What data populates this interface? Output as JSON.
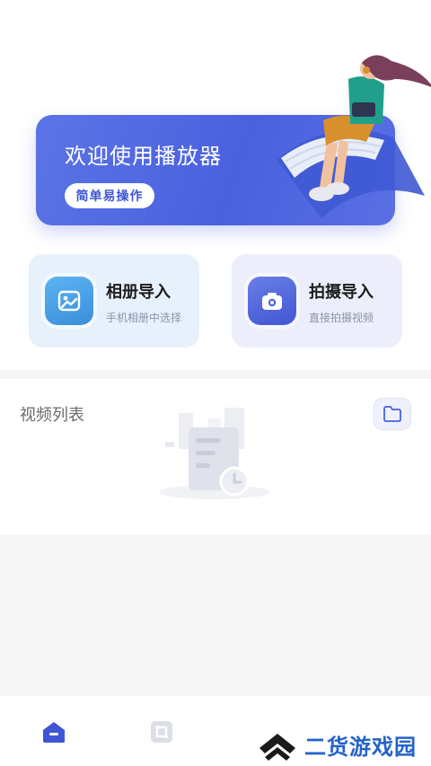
{
  "banner": {
    "title": "欢迎使用播放器",
    "button": "简单易操作"
  },
  "cards": [
    {
      "title": "相册导入",
      "subtitle": "手机相册中选择",
      "icon": "gallery-icon"
    },
    {
      "title": "拍摄导入",
      "subtitle": "直接拍摄视频",
      "icon": "camera-icon"
    }
  ],
  "video_section": {
    "title": "视频列表",
    "folder_icon": "folder-icon"
  },
  "tabbar": {
    "items": [
      {
        "icon": "home-icon",
        "active": true
      },
      {
        "icon": "crop-icon",
        "active": false
      }
    ]
  },
  "watermark": {
    "text": "二货游戏园"
  },
  "colors": {
    "primary": "#4a61de",
    "album_accent": "#3a8edb",
    "watermark": "#2563c9"
  }
}
